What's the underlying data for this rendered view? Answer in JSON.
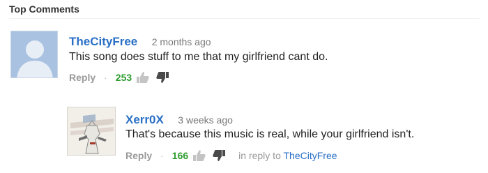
{
  "section": {
    "title": "Top Comments"
  },
  "comments": [
    {
      "author": "TheCityFree",
      "time": "2 months ago",
      "text": "This song does stuff to me that my girlfriend cant do.",
      "reply_label": "Reply",
      "separator": "·",
      "likes": "253",
      "avatar": "default-user-avatar"
    },
    {
      "author": "Xerr0X",
      "time": "3 weeks ago",
      "text": "That's because this music is real, while your girlfriend isn't.",
      "reply_label": "Reply",
      "separator": "·",
      "likes": "166",
      "in_reply_prefix": "in reply to",
      "in_reply_to": "TheCityFree",
      "avatar": "assassins-creed-avatar",
      "avatar_title": "ASSASSIN'S CREED"
    }
  ],
  "colors": {
    "author": "#2a6fc6",
    "likes": "#2e9c2e",
    "muted": "#999999"
  }
}
